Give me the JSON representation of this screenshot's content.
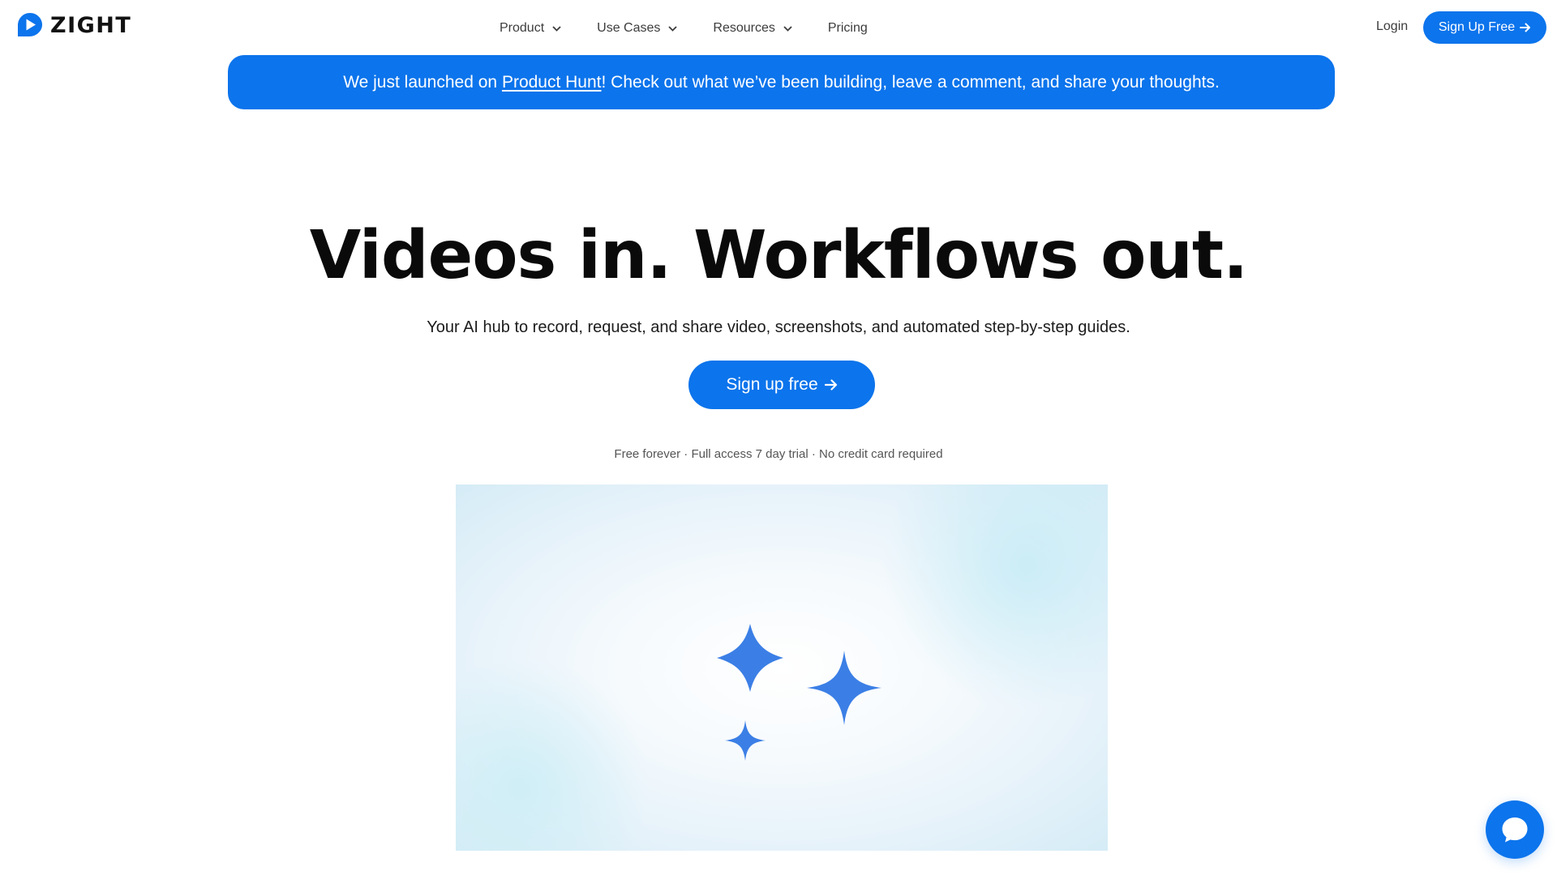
{
  "brand": {
    "name": "ZIGHT",
    "accent_color": "#0c74ec",
    "logo_icon": "play-bubble-icon"
  },
  "nav": {
    "items": [
      {
        "label": "Product",
        "has_dropdown": true
      },
      {
        "label": "Use Cases",
        "has_dropdown": true
      },
      {
        "label": "Resources",
        "has_dropdown": true
      },
      {
        "label": "Pricing",
        "has_dropdown": false
      }
    ],
    "login_label": "Login",
    "signup_label": "Sign Up Free"
  },
  "banner": {
    "prefix": "We just launched on ",
    "link_text": "Product Hunt",
    "suffix": "! Check out what we’ve been building, leave a comment, and share your thoughts."
  },
  "hero": {
    "title": "Videos in. Workflows out.",
    "subtitle": "Your AI hub to record, request, and share video, screenshots, and automated step-by-step guides.",
    "cta_label": "Sign up free",
    "note": "Free forever · Full access 7 day trial · No credit card required"
  },
  "media": {
    "icon": "sparkles-icon",
    "sparkle_color": "#3b7fe6"
  },
  "chat": {
    "icon": "chat-bubble-icon"
  }
}
